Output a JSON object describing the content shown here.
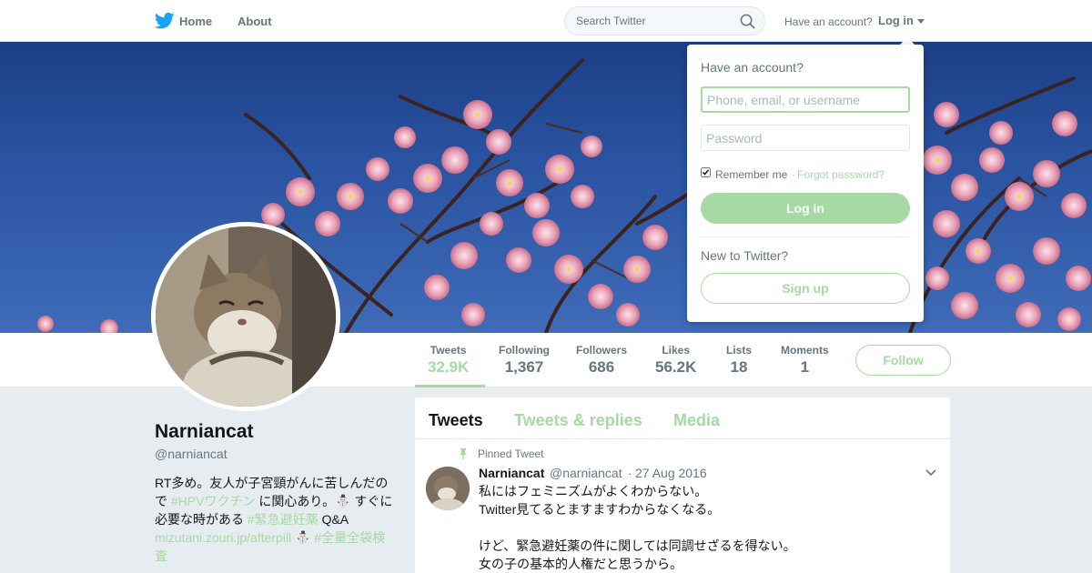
{
  "nav": {
    "home_label": "Home",
    "about_label": "About",
    "search_placeholder": "Search Twitter",
    "have_account_label": "Have an account?",
    "login_label": "Log in"
  },
  "profile": {
    "name": "Narniancat",
    "handle": "@narniancat",
    "bio_parts": {
      "p1": "RT多め。友人が子宮頸がんに苦しんだので ",
      "tag1": "#HPVワクチン",
      "p2": " に関心あり。",
      "emoji1": "⛄",
      "p3": " すぐに必要な時がある ",
      "tag2": "#緊急避妊薬",
      "p4": " Q&A ",
      "link": "mizutani.zouri.jp/afterpill",
      "emoji2": "⛄",
      "tag3": " #全量全袋検査"
    }
  },
  "stats": [
    {
      "label": "Tweets",
      "value": "32.9K"
    },
    {
      "label": "Following",
      "value": "1,367"
    },
    {
      "label": "Followers",
      "value": "686"
    },
    {
      "label": "Likes",
      "value": "56.2K"
    },
    {
      "label": "Lists",
      "value": "18"
    },
    {
      "label": "Moments",
      "value": "1"
    }
  ],
  "follow_label": "Follow",
  "tabs": [
    "Tweets",
    "Tweets & replies",
    "Media"
  ],
  "tweet": {
    "pinned_label": "Pinned Tweet",
    "name": "Narniancat",
    "handle": "@narniancat",
    "separator": "·",
    "date": "27 Aug 2016",
    "lines": [
      "私にはフェミニズムがよくわからない。",
      "Twitter見てるとますますわからなくなる。",
      "",
      "けど、緊急避妊薬の件に関しては同調せざるを得ない。",
      "女の子の基本的人権だと思うから。"
    ]
  },
  "login_dropdown": {
    "title": "Have an account?",
    "username_placeholder": "Phone, email, or username",
    "password_placeholder": "Password",
    "remember_label": "Remember me",
    "separator": "·",
    "forgot_label": "Forgot password?",
    "login_button": "Log in",
    "new_label": "New to Twitter?",
    "signup_button": "Sign up"
  },
  "colors": {
    "accent": "#a6d9a3",
    "twitter_blue": "#1da1f2",
    "text_gray": "#66757f",
    "background": "#e6ecf0"
  }
}
